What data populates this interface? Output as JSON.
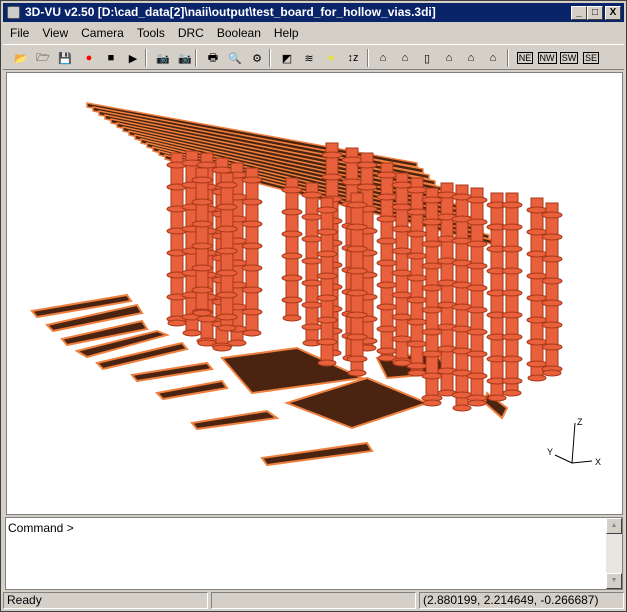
{
  "window": {
    "title": "3D-VU v2.50 [D:\\cad_data[2]\\naii\\output\\test_board_for_hollow_vias.3di]",
    "minimize": "_",
    "maximize": "□",
    "close": "X"
  },
  "menu": [
    "File",
    "View",
    "Camera",
    "Tools",
    "DRC",
    "Boolean",
    "Help"
  ],
  "toolbar": [
    {
      "icon": "open-folder-icon",
      "glyph": "📂"
    },
    {
      "icon": "open-multiple-icon",
      "glyph": "🗁"
    },
    {
      "icon": "save-icon",
      "glyph": "💾"
    },
    {
      "icon": "record-icon",
      "glyph": "●",
      "color": "#ff0000"
    },
    {
      "icon": "stop-icon",
      "glyph": "■"
    },
    {
      "icon": "play-icon",
      "glyph": "▶"
    },
    {
      "icon": "camera-icon",
      "glyph": "📷"
    },
    {
      "icon": "camera-delete-icon",
      "glyph": "📷"
    },
    {
      "icon": "print-icon",
      "glyph": "🖶"
    },
    {
      "icon": "print-preview-icon",
      "glyph": "🔍"
    },
    {
      "icon": "print-setup-icon",
      "glyph": "⚙"
    },
    {
      "icon": "color-icon",
      "glyph": "◩"
    },
    {
      "icon": "layers-icon",
      "glyph": "≋"
    },
    {
      "icon": "light-icon",
      "glyph": "✶",
      "color": "#e8e800"
    },
    {
      "icon": "z-scale-icon",
      "glyph": "↕z"
    },
    {
      "icon": "view-1-icon",
      "glyph": "⌂"
    },
    {
      "icon": "view-2-icon",
      "glyph": "⌂"
    },
    {
      "icon": "view-3-icon",
      "glyph": "▯"
    },
    {
      "icon": "view-4-icon",
      "glyph": "⌂"
    },
    {
      "icon": "view-5-icon",
      "glyph": "⌂"
    },
    {
      "icon": "view-6-icon",
      "glyph": "⌂"
    },
    {
      "icon": "view-ne-icon",
      "glyph": "NE"
    },
    {
      "icon": "view-nw-icon",
      "glyph": "NW"
    },
    {
      "icon": "view-sw-icon",
      "glyph": "SW"
    },
    {
      "icon": "view-se-icon",
      "glyph": "SE"
    }
  ],
  "axes": {
    "x": "X",
    "y": "Y",
    "z": "Z"
  },
  "colors": {
    "via": "#e8603c",
    "via_dark": "#a83818",
    "trace": "#4a2410",
    "trace_edge": "#f08040"
  },
  "command": {
    "prompt": "Command >"
  },
  "status": {
    "left": "Ready",
    "middle": "",
    "coords": "(2.880199, 2.214649, -0.266687)"
  }
}
